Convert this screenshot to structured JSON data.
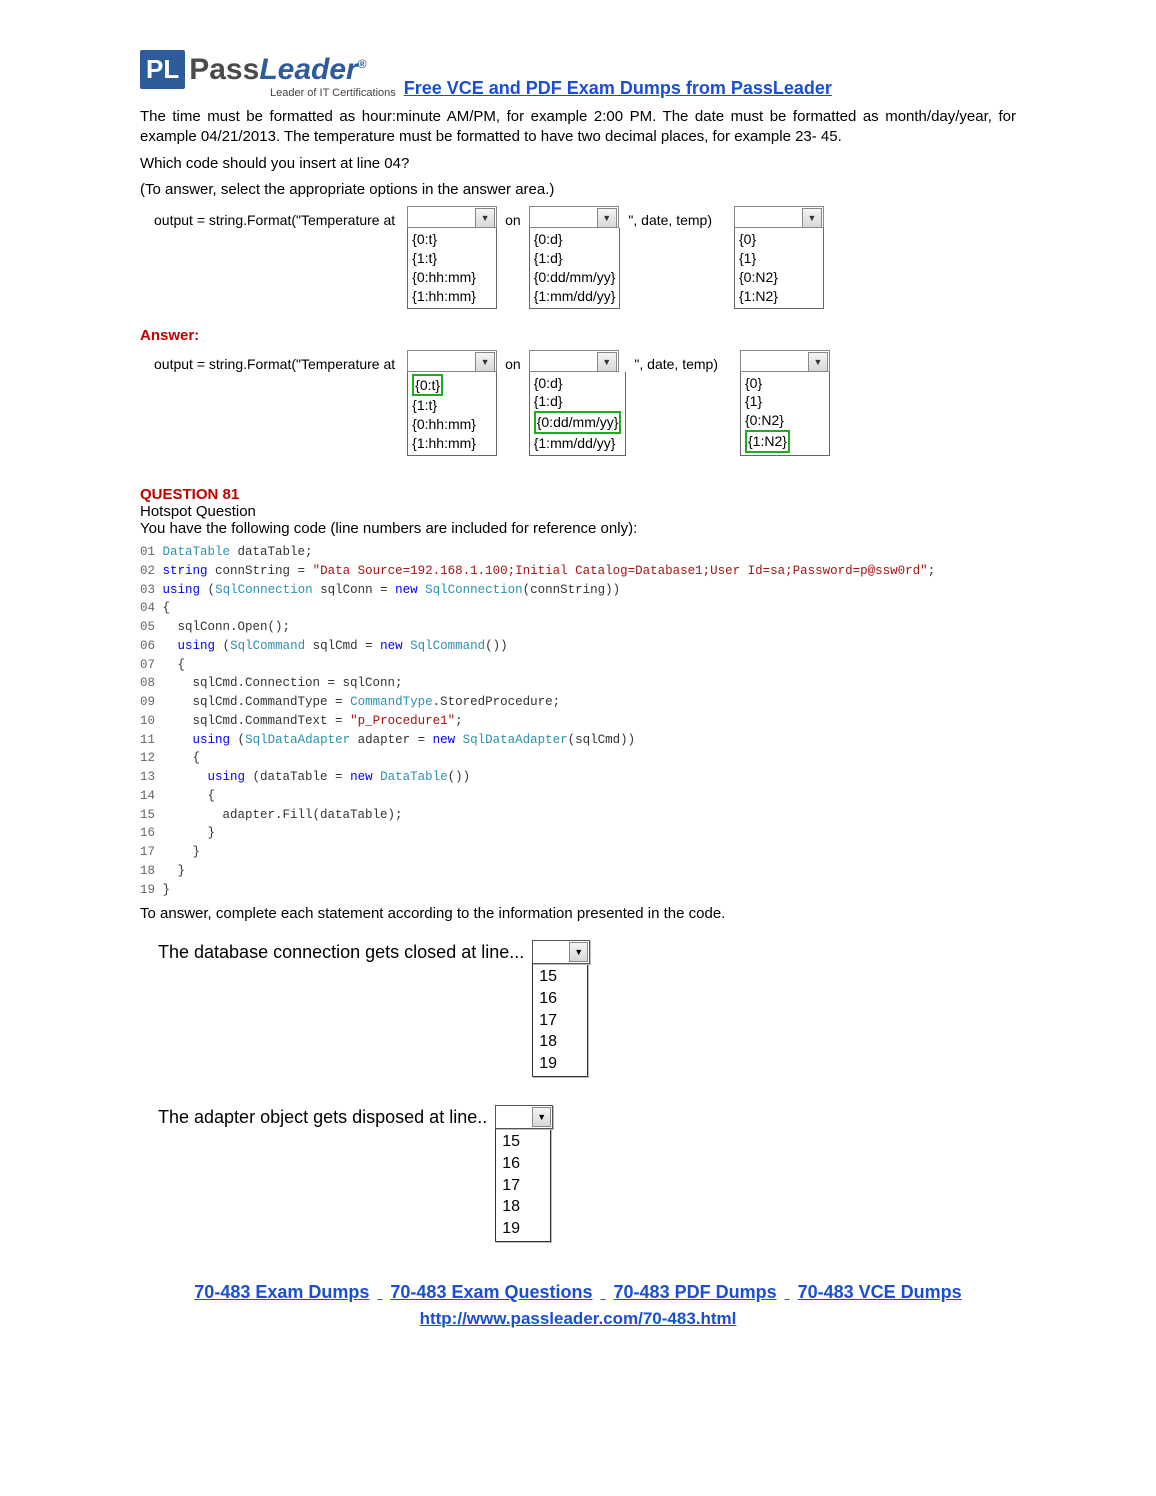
{
  "header": {
    "logo_p": "P",
    "logo_l": "L",
    "logo_pass": "Pass",
    "logo_leader": "Leader",
    "tagline": "Leader of IT Certifications",
    "headline": "Free VCE and PDF Exam Dumps from PassLeader"
  },
  "intro": {
    "p1": "The time must be formatted as hour:minute AM/PM, for example 2:00 PM. The date must be formatted as month/day/year, for example 04/21/2013. The temperature must be formatted to have two decimal places, for example 23- 45.",
    "p2": "Which code should you insert at line 04?",
    "p3": "(To answer, select the appropriate options in the answer area.)"
  },
  "row1": {
    "label": "output = string.Format(\"Temperature at",
    "mid1": "on",
    "trail": "\", date, temp)",
    "d1": [
      "{0:t}",
      "{1:t}",
      "{0:hh:mm}",
      "{1:hh:mm}"
    ],
    "d2": [
      "{0:d}",
      "{1:d}",
      "{0:dd/mm/yy}",
      "{1:mm/dd/yy}"
    ],
    "d3": [
      "{0}",
      "{1}",
      "{0:N2}",
      "{1:N2}"
    ]
  },
  "answer_label": "Answer:",
  "row2": {
    "label": "output = string.Format(\"Temperature at",
    "mid1": "on",
    "trail": "\", date, temp)",
    "d1": [
      "{0:t}",
      "{1:t}",
      "{0:hh:mm}",
      "{1:hh:mm}"
    ],
    "d1_sel": 0,
    "d2": [
      "{0:d}",
      "{1:d}",
      "{0:dd/mm/yy}",
      "{1:mm/dd/yy}"
    ],
    "d2_sel": 2,
    "d3": [
      "{0}",
      "{1}",
      "{0:N2}",
      "{1:N2}"
    ],
    "d3_sel": 3
  },
  "q81": {
    "title": "QUESTION 81",
    "sub": "Hotspot Question",
    "prompt": "You have the following code (line numbers are included for reference only):",
    "after": "To answer, complete each statement according to the information presented in the code.",
    "stmt1": "The database connection gets closed at line...",
    "stmt1_opts": [
      "15",
      "16",
      "17",
      "18",
      "19"
    ],
    "stmt2": "The adapter object gets disposed at line..",
    "stmt2_opts": [
      "15",
      "16",
      "17",
      "18",
      "19"
    ]
  },
  "footer": {
    "l1": "70-483 Exam Dumps",
    "l2": "70-483 Exam Questions",
    "l3": "70-483 PDF Dumps",
    "l4": "70-483 VCE Dumps",
    "url": "http://www.passleader.com/70-483.html"
  }
}
